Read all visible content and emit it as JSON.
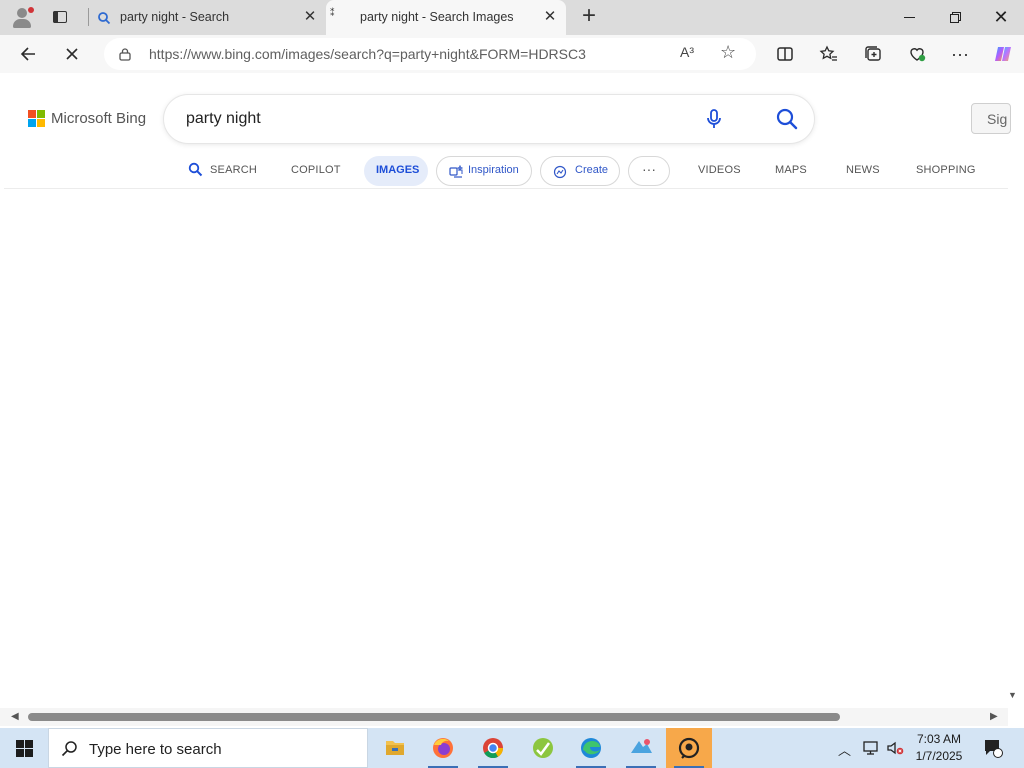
{
  "browser": {
    "tabs": [
      {
        "title": "party night - Search",
        "active": false
      },
      {
        "title": "party night - Search Images",
        "active": true
      }
    ],
    "address_url": "https://www.bing.com/images/search?q=party+night&FORM=HDRSC3",
    "read_aloud_label": "A³"
  },
  "bing": {
    "logo_text": "Microsoft Bing",
    "query": "party night",
    "sign_in_label": "Sig",
    "scopes": {
      "search": "SEARCH",
      "copilot": "COPILOT",
      "images": "IMAGES",
      "inspiration": "Inspiration",
      "create": "Create",
      "more": "···",
      "videos": "VIDEOS",
      "maps": "MAPS",
      "news": "NEWS",
      "shopping": "SHOPPING"
    },
    "accent_color": "#1d4ed8"
  },
  "taskbar": {
    "search_placeholder": "Type here to search",
    "time": "7:03 AM",
    "date": "1/7/2025",
    "apps": [
      "file-explorer",
      "firefox",
      "chrome",
      "app-green",
      "edge",
      "app-blue",
      "app-orange"
    ]
  }
}
